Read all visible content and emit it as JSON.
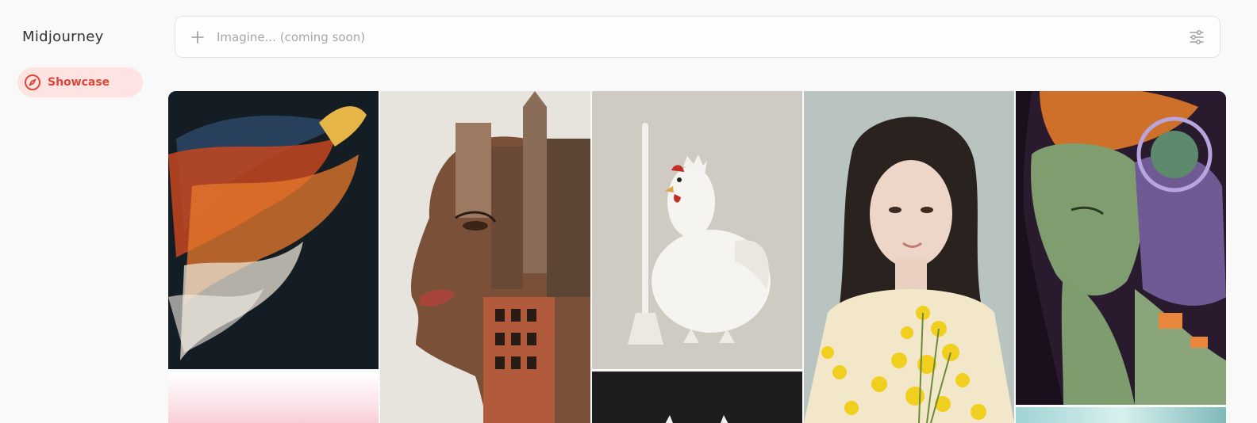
{
  "app": {
    "title": "Midjourney"
  },
  "sidebar": {
    "items": [
      {
        "label": "Showcase",
        "icon": "compass-icon",
        "active": true
      }
    ]
  },
  "prompt": {
    "placeholder": "Imagine... (coming soon)",
    "value": "",
    "icons": {
      "leading": "plus-icon",
      "trailing": "settings-sliders-icon"
    }
  },
  "colors": {
    "accent": "#e0453a",
    "accent_bg": "#fde4e2",
    "page_bg": "#f9f9f9"
  },
  "gallery": {
    "images": [
      {
        "subject": "phoenix made of words"
      },
      {
        "subject": "face composed of city buildings"
      },
      {
        "subject": "white ceramic chicken with broom"
      },
      {
        "subject": "woman holding yellow flowers"
      },
      {
        "subject": "green cyborg with purple mechanical parts"
      }
    ]
  }
}
